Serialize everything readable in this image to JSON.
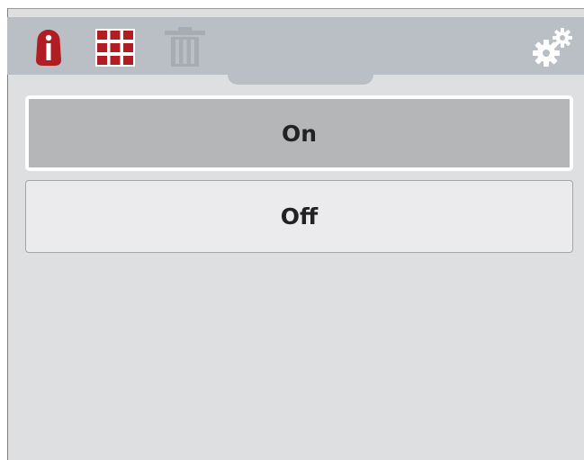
{
  "toolbar": {
    "icons": [
      {
        "name": "info-icon",
        "color": "#b01e23"
      },
      {
        "name": "grid-icon",
        "color": "#b01e23"
      },
      {
        "name": "trash-icon",
        "color": "#a6acb3"
      },
      {
        "name": "gears-icon",
        "color": "#ffffff"
      }
    ]
  },
  "options": {
    "on_label": "On",
    "off_label": "Off",
    "selected": "On"
  },
  "colors": {
    "accent": "#b01e23",
    "toolbar_bg": "#b9bfc5",
    "panel_bg": "#dedfe0",
    "selected_bg": "#b5b6b8",
    "unselected_bg": "#ebebed"
  }
}
